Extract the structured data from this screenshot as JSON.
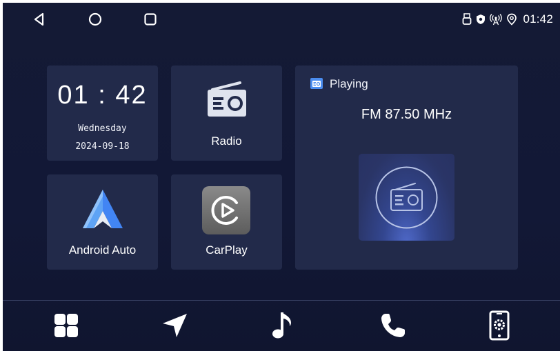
{
  "status_bar": {
    "time": "01:42",
    "icons": [
      "usb-icon",
      "shield-icon",
      "hotspot-icon",
      "location-icon"
    ]
  },
  "nav_buttons": [
    "back-icon",
    "home-icon",
    "recents-icon"
  ],
  "clock_widget": {
    "time": "01 : 42",
    "weekday": "Wednesday",
    "date": "2024-09-18"
  },
  "apps": {
    "radio": {
      "label": "Radio",
      "icon": "radio-icon"
    },
    "android_auto": {
      "label": "Android Auto",
      "icon": "android-auto-icon"
    },
    "carplay": {
      "label": "CarPlay",
      "icon": "carplay-icon"
    }
  },
  "player": {
    "status": "Playing",
    "station": "FM 87.50 MHz",
    "art_icon": "radio-icon"
  },
  "dock": {
    "items": [
      "apps-grid-icon",
      "navigation-icon",
      "music-icon",
      "phone-icon",
      "phone-link-settings-icon"
    ]
  },
  "colors": {
    "background": "#131a36",
    "tile": "#222a4a",
    "accent_blue": "#3f8ee8"
  }
}
